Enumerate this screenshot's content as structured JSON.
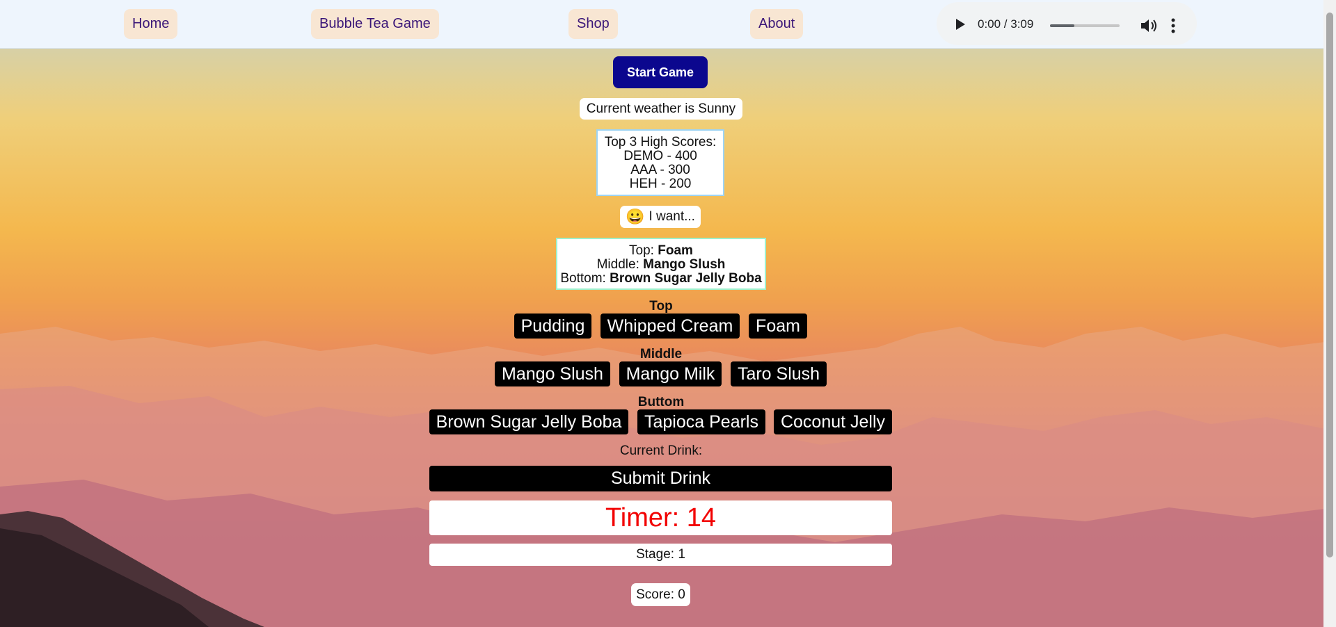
{
  "nav": {
    "items": [
      {
        "label": "Home"
      },
      {
        "label": "Bubble Tea Game"
      },
      {
        "label": "Shop"
      },
      {
        "label": "About"
      }
    ]
  },
  "audio": {
    "time": "0:00 / 3:09",
    "volume_level": 0.35,
    "icons": [
      "play-icon",
      "volume-icon",
      "more-options-icon"
    ]
  },
  "game": {
    "start_label": "Start Game",
    "weather": "Current weather is Sunny",
    "high_scores": {
      "title": "Top 3 High Scores:",
      "entries": [
        "DEMO - 400",
        "AAA - 300",
        "HEH - 200"
      ]
    },
    "customer": {
      "emoji": "😀",
      "prompt": "I want..."
    },
    "order": {
      "top_label": "Top: ",
      "top_value": "Foam",
      "middle_label": "Middle: ",
      "middle_value": "Mango Slush",
      "bottom_label": "Bottom: ",
      "bottom_value": "Brown Sugar Jelly Boba"
    },
    "sections": {
      "top": {
        "label": "Top",
        "options": [
          "Pudding",
          "Whipped Cream",
          "Foam"
        ]
      },
      "middle": {
        "label": "Middle",
        "options": [
          "Mango Slush",
          "Mango Milk",
          "Taro Slush"
        ]
      },
      "bottom": {
        "label": "Buttom",
        "options": [
          "Brown Sugar Jelly Boba",
          "Tapioca Pearls",
          "Coconut Jelly"
        ]
      }
    },
    "current_drink_label": "Current Drink:",
    "submit_label": "Submit Drink",
    "timer": "Timer: 14",
    "stage": "Stage: 1",
    "score": "Score: 0"
  },
  "colors": {
    "start_button": "#0b078e",
    "timer_text": "#f20000",
    "nav_button_bg": "#f8e6d3",
    "nav_text": "#3a1678"
  }
}
